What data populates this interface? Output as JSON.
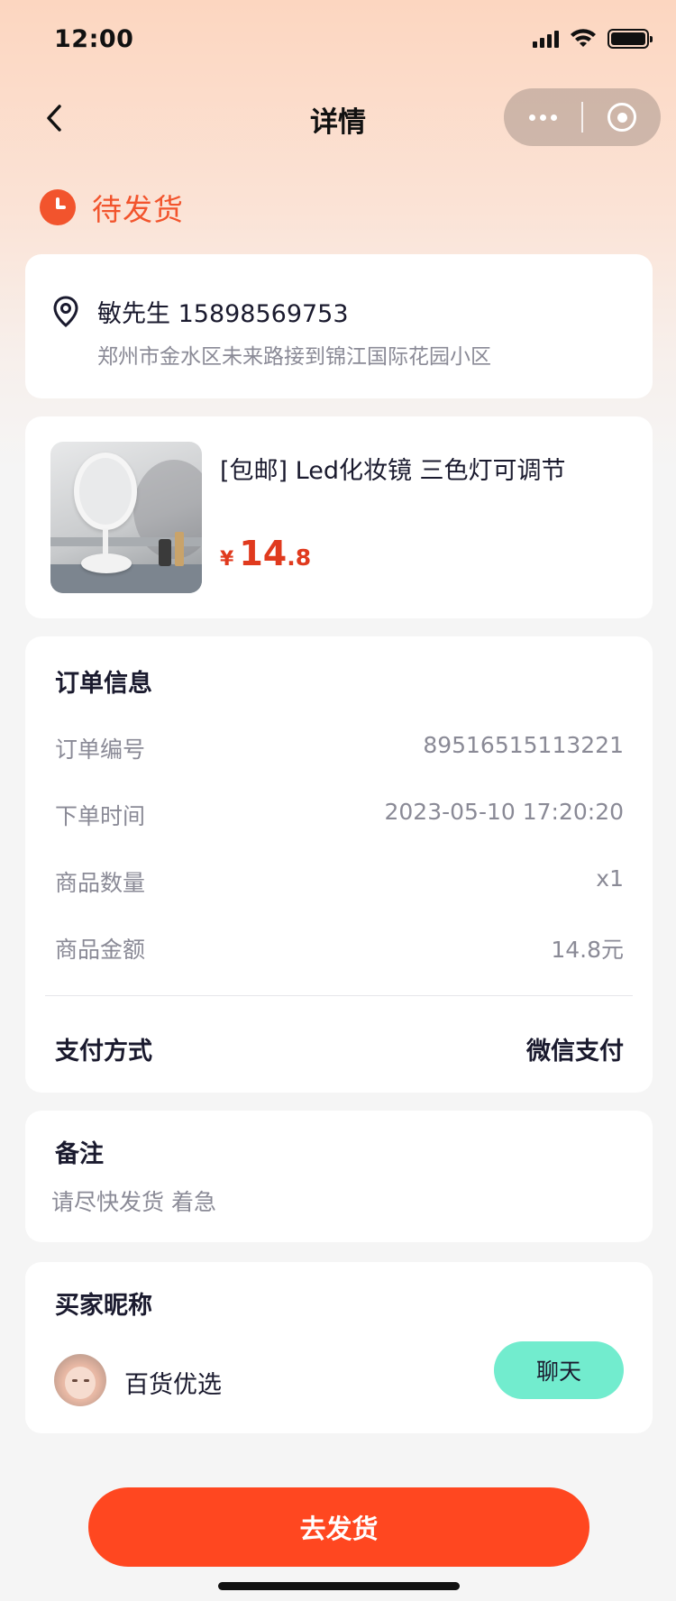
{
  "status_bar": {
    "time": "12:00"
  },
  "nav": {
    "title": "详情"
  },
  "order_status": {
    "label": "待发货",
    "color": "#f2542d"
  },
  "address": {
    "name_phone": "敏先生 15898569753",
    "detail": "郑州市金水区未来路接到锦江国际花园小区"
  },
  "product": {
    "title": "[包邮] Led化妆镜 三色灯可调节",
    "price_symbol": "¥",
    "price_int": "14",
    "price_dec": ".8"
  },
  "order_info": {
    "title": "订单信息",
    "rows": [
      {
        "label": "订单编号",
        "value": "89516515113221"
      },
      {
        "label": "下单时间",
        "value": "2023-05-10 17:20:20"
      },
      {
        "label": "商品数量",
        "value": "x1"
      },
      {
        "label": "商品金额",
        "value": "14.8元"
      }
    ],
    "payment_label": "支付方式",
    "payment_value": "微信支付"
  },
  "remark": {
    "title": "备注",
    "text": "请尽快发货 着急"
  },
  "buyer": {
    "title": "买家昵称",
    "name": "百货优选",
    "chat_label": "聊天"
  },
  "actions": {
    "ship_label": "去发货"
  },
  "colors": {
    "accent": "#ff4720",
    "price": "#e03a1e",
    "chat": "#72ecce"
  }
}
